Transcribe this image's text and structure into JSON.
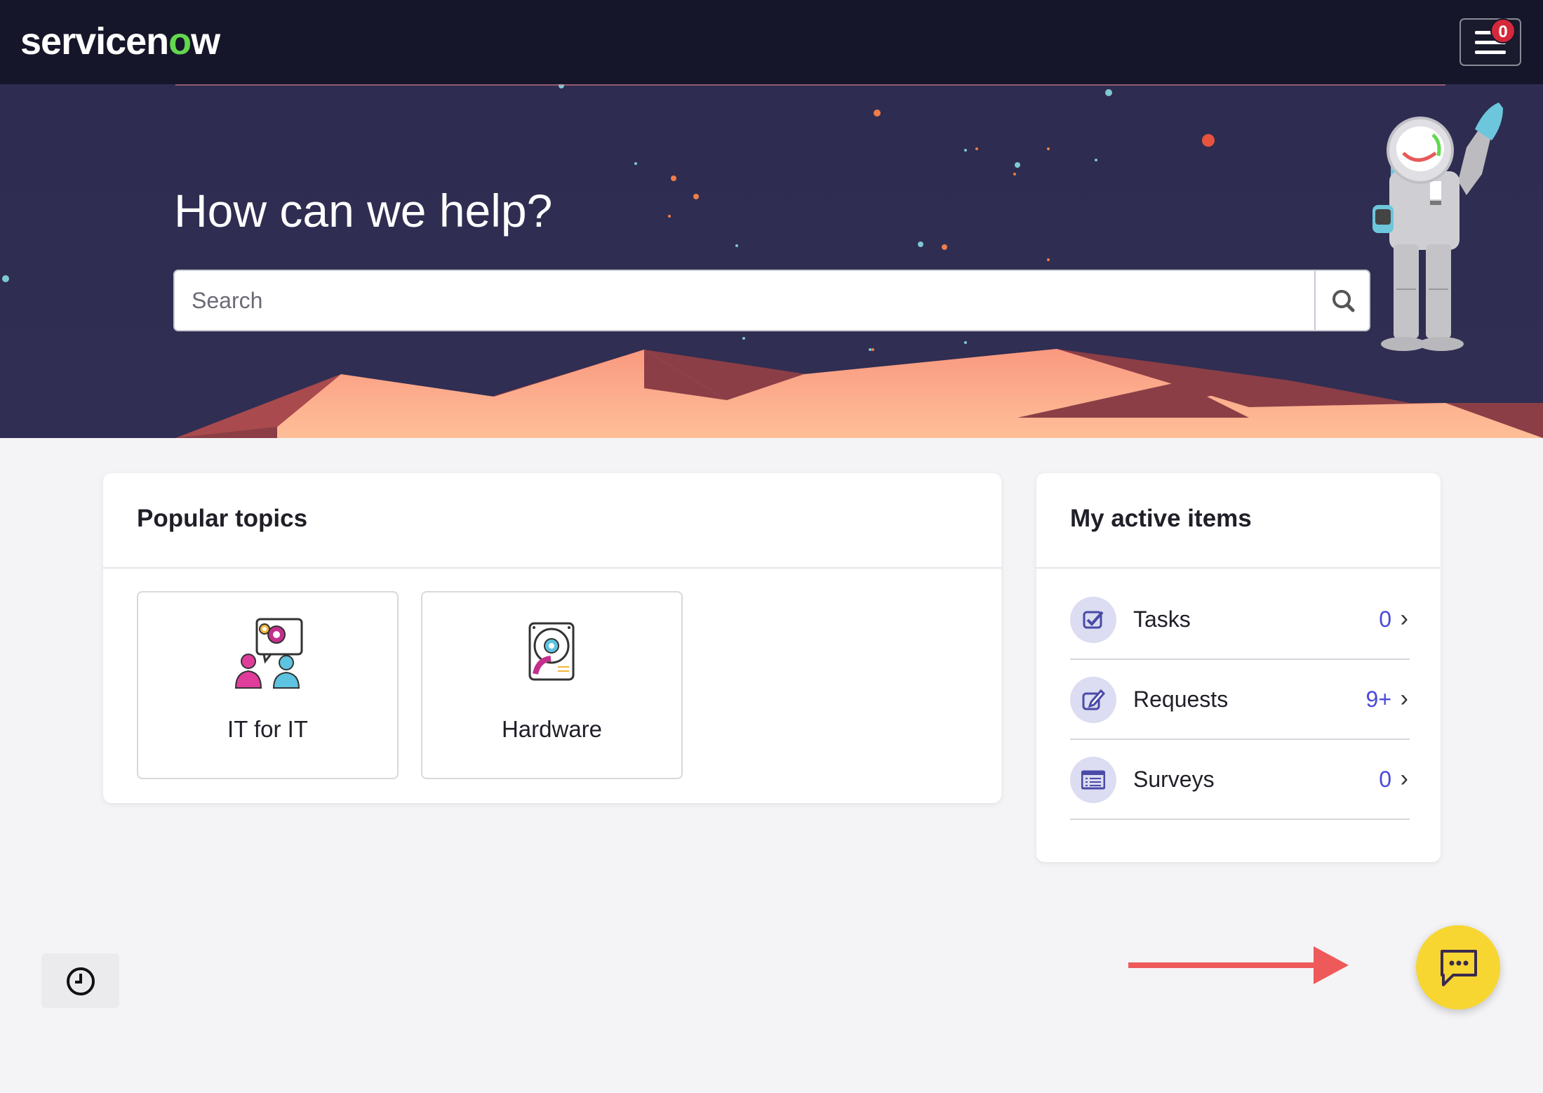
{
  "header": {
    "logo_text_a": "servicen",
    "logo_text_b": "o",
    "logo_text_c": "w",
    "menu_icon": "hamburger-menu-icon",
    "notification_count": "0"
  },
  "hero": {
    "title": "How can we help?",
    "search_placeholder": "Search",
    "search_icon": "search-icon"
  },
  "popular_topics": {
    "title": "Popular topics",
    "tiles": [
      {
        "label": "IT for IT",
        "icon": "people-gears-icon"
      },
      {
        "label": "Hardware",
        "icon": "hard-drive-icon"
      }
    ]
  },
  "active_items": {
    "title": "My active items",
    "rows": [
      {
        "label": "Tasks",
        "count": "0",
        "icon": "checkbox-icon"
      },
      {
        "label": "Requests",
        "count": "9+",
        "icon": "edit-icon"
      },
      {
        "label": "Surveys",
        "count": "0",
        "icon": "list-icon"
      }
    ]
  },
  "footer": {
    "history_icon": "clock-icon",
    "chat_icon": "chat-icon"
  },
  "colors": {
    "header_bg": "#16162a",
    "hero_bg": "#2e2c50",
    "accent_link": "#4a4ad8",
    "chat_button": "#f7d632",
    "annotation_arrow": "#ee5a5a"
  }
}
